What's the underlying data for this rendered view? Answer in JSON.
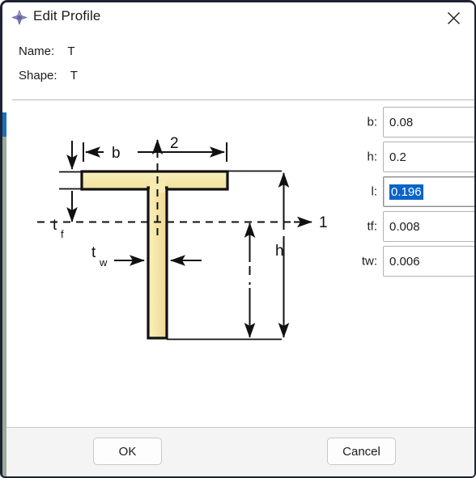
{
  "window": {
    "title": "Edit Profile",
    "icon": "profile-cross-icon",
    "close_icon": "close-icon"
  },
  "header": {
    "name_label": "Name:",
    "name_value": "T",
    "shape_label": "Shape:",
    "shape_value": "T"
  },
  "fields": [
    {
      "label": "b:",
      "value": "0.08",
      "name": "b",
      "focused": false,
      "selected": false
    },
    {
      "label": "h:",
      "value": "0.2",
      "name": "h",
      "focused": false,
      "selected": false
    },
    {
      "label": "l:",
      "value": "0.196",
      "name": "l",
      "focused": true,
      "selected": true
    },
    {
      "label": "tf:",
      "value": "0.008",
      "name": "tf",
      "focused": false,
      "selected": false
    },
    {
      "label": "tw:",
      "value": "0.006",
      "name": "tw",
      "focused": false,
      "selected": false
    }
  ],
  "diagram": {
    "description": "T-section profile cross-section with dimension annotations",
    "fill_color": "#f5e6a8",
    "outline_color": "#000000",
    "labels": {
      "axis_2": "2",
      "axis_1": "1",
      "width": "b",
      "height": "h",
      "flange_thickness_main": "t",
      "flange_thickness_sub": "f",
      "web_thickness_main": "t",
      "web_thickness_sub": "w"
    }
  },
  "footer": {
    "ok_label": "OK",
    "cancel_label": "Cancel"
  },
  "colors": {
    "accent": "#0a64c8",
    "scroll_thumb": "#1b6ec2",
    "profile_fill": "#f5e6a8",
    "frame": "#1c2433"
  }
}
